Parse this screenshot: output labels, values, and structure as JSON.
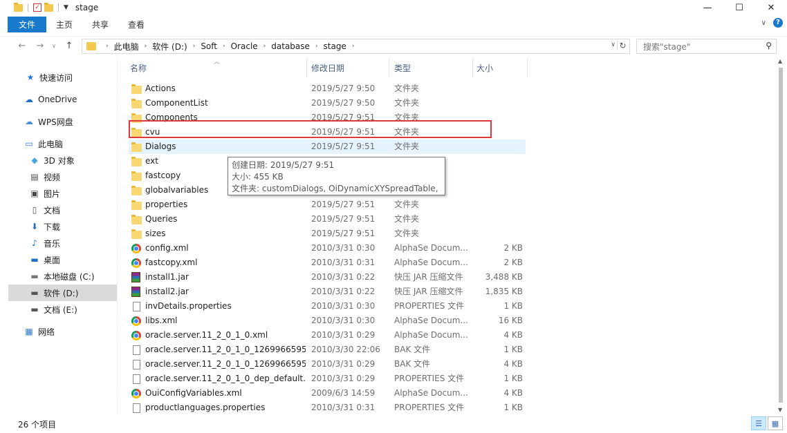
{
  "window": {
    "title": "stage",
    "minimize_icon": "—",
    "maximize_icon": "☐",
    "close_icon": "✕"
  },
  "ribbon": {
    "tabs": [
      "文件",
      "主页",
      "共享",
      "查看"
    ],
    "accent": "#1979ca"
  },
  "address": {
    "crumbs": [
      "此电脑",
      "软件 (D:)",
      "Soft",
      "Oracle",
      "database",
      "stage"
    ],
    "search_placeholder": "搜索\"stage\""
  },
  "sidebar": {
    "items": [
      {
        "label": "快速访问",
        "icon": "star-icon",
        "glyph": "★",
        "color": "#2a78d6"
      },
      {
        "label": "OneDrive",
        "icon": "cloud-icon",
        "glyph": "☁",
        "color": "#1a6fc9"
      },
      {
        "label": "WPS网盘",
        "icon": "cloud-outline-icon",
        "glyph": "☁",
        "color": "#4a90d9"
      },
      {
        "label": "此电脑",
        "icon": "computer-icon",
        "glyph": "▭",
        "color": "#2b7bd0"
      },
      {
        "label": "3D 对象",
        "icon": "cube-icon",
        "glyph": "◆",
        "color": "#46a6e0"
      },
      {
        "label": "视频",
        "icon": "video-icon",
        "glyph": "▤",
        "color": "#444"
      },
      {
        "label": "图片",
        "icon": "picture-icon",
        "glyph": "▣",
        "color": "#444"
      },
      {
        "label": "文档",
        "icon": "document-icon",
        "glyph": "▯",
        "color": "#555"
      },
      {
        "label": "下载",
        "icon": "download-icon",
        "glyph": "⬇",
        "color": "#1f6fc6"
      },
      {
        "label": "音乐",
        "icon": "music-icon",
        "glyph": "♪",
        "color": "#1f6fc6"
      },
      {
        "label": "桌面",
        "icon": "desktop-icon",
        "glyph": "▬",
        "color": "#1f6fc6"
      },
      {
        "label": "本地磁盘 (C:)",
        "icon": "drive-c-icon",
        "glyph": "▬",
        "color": "#777"
      },
      {
        "label": "软件 (D:)",
        "icon": "drive-d-icon",
        "glyph": "▬",
        "color": "#555"
      },
      {
        "label": "文档 (E:)",
        "icon": "drive-e-icon",
        "glyph": "▬",
        "color": "#555"
      },
      {
        "label": "网络",
        "icon": "network-icon",
        "glyph": "▦",
        "color": "#2b7bd0"
      }
    ]
  },
  "columns": {
    "name": "名称",
    "date": "修改日期",
    "type": "类型",
    "size": "大小"
  },
  "files": [
    {
      "name": "Actions",
      "date": "2019/5/27 9:50",
      "type": "文件夹",
      "size": "",
      "icon": "folder"
    },
    {
      "name": "ComponentList",
      "date": "2019/5/27 9:50",
      "type": "文件夹",
      "size": "",
      "icon": "folder"
    },
    {
      "name": "Components",
      "date": "2019/5/27 9:51",
      "type": "文件夹",
      "size": "",
      "icon": "folder"
    },
    {
      "name": "cvu",
      "date": "2019/5/27 9:51",
      "type": "文件夹",
      "size": "",
      "icon": "folder"
    },
    {
      "name": "Dialogs",
      "date": "2019/5/27 9:51",
      "type": "文件夹",
      "size": "",
      "icon": "folder"
    },
    {
      "name": "ext",
      "date": "",
      "type": "",
      "size": "",
      "icon": "folder"
    },
    {
      "name": "fastcopy",
      "date": "",
      "type": "",
      "size": "",
      "icon": "folder"
    },
    {
      "name": "globalvariables",
      "date": "",
      "type": "",
      "size": "",
      "icon": "folder"
    },
    {
      "name": "properties",
      "date": "2019/5/27 9:51",
      "type": "文件夹",
      "size": "",
      "icon": "folder"
    },
    {
      "name": "Queries",
      "date": "2019/5/27 9:51",
      "type": "文件夹",
      "size": "",
      "icon": "folder"
    },
    {
      "name": "sizes",
      "date": "2019/5/27 9:51",
      "type": "文件夹",
      "size": "",
      "icon": "folder"
    },
    {
      "name": "config.xml",
      "date": "2010/3/31 0:30",
      "type": "AlphaSe Docum...",
      "size": "2 KB",
      "icon": "chrome"
    },
    {
      "name": "fastcopy.xml",
      "date": "2010/3/31 0:31",
      "type": "AlphaSe Docum...",
      "size": "2 KB",
      "icon": "chrome"
    },
    {
      "name": "install1.jar",
      "date": "2010/3/31 0:22",
      "type": "快压 JAR 压缩文件",
      "size": "3,488 KB",
      "icon": "jar"
    },
    {
      "name": "install2.jar",
      "date": "2010/3/31 0:22",
      "type": "快压 JAR 压缩文件",
      "size": "1,835 KB",
      "icon": "jar"
    },
    {
      "name": "invDetails.properties",
      "date": "2010/3/31 0:30",
      "type": "PROPERTIES 文件",
      "size": "1 KB",
      "icon": "doc"
    },
    {
      "name": "libs.xml",
      "date": "2010/3/31 0:30",
      "type": "AlphaSe Docum...",
      "size": "16 KB",
      "icon": "chrome"
    },
    {
      "name": "oracle.server.11_2_0_1_0.xml",
      "date": "2010/3/31 0:29",
      "type": "AlphaSe Docum...",
      "size": "4 KB",
      "icon": "chrome"
    },
    {
      "name": "oracle.server.11_2_0_1_0_1269966595...",
      "date": "2010/3/30 22:06",
      "type": "BAK 文件",
      "size": "1 KB",
      "icon": "doc"
    },
    {
      "name": "oracle.server.11_2_0_1_0_1269966595...",
      "date": "2010/3/31 0:29",
      "type": "BAK 文件",
      "size": "4 KB",
      "icon": "doc"
    },
    {
      "name": "oracle.server.11_2_0_1_0_dep_default....",
      "date": "2010/3/31 0:29",
      "type": "PROPERTIES 文件",
      "size": "1 KB",
      "icon": "doc"
    },
    {
      "name": "OuiConfigVariables.xml",
      "date": "2009/6/3 14:59",
      "type": "AlphaSe Docum...",
      "size": "4 KB",
      "icon": "chrome"
    },
    {
      "name": "productlanguages.properties",
      "date": "2010/3/31 0:31",
      "type": "PROPERTIES 文件",
      "size": "1 KB",
      "icon": "doc"
    }
  ],
  "tooltip": {
    "line1": "创建日期: 2019/5/27 9:51",
    "line2": "大小: 455 KB",
    "line3": "文件夹: customDialogs, OiDynamicXYSpreadTable, ..."
  },
  "status": {
    "count": "26 个项目"
  },
  "highlight_color": "#e0363c"
}
